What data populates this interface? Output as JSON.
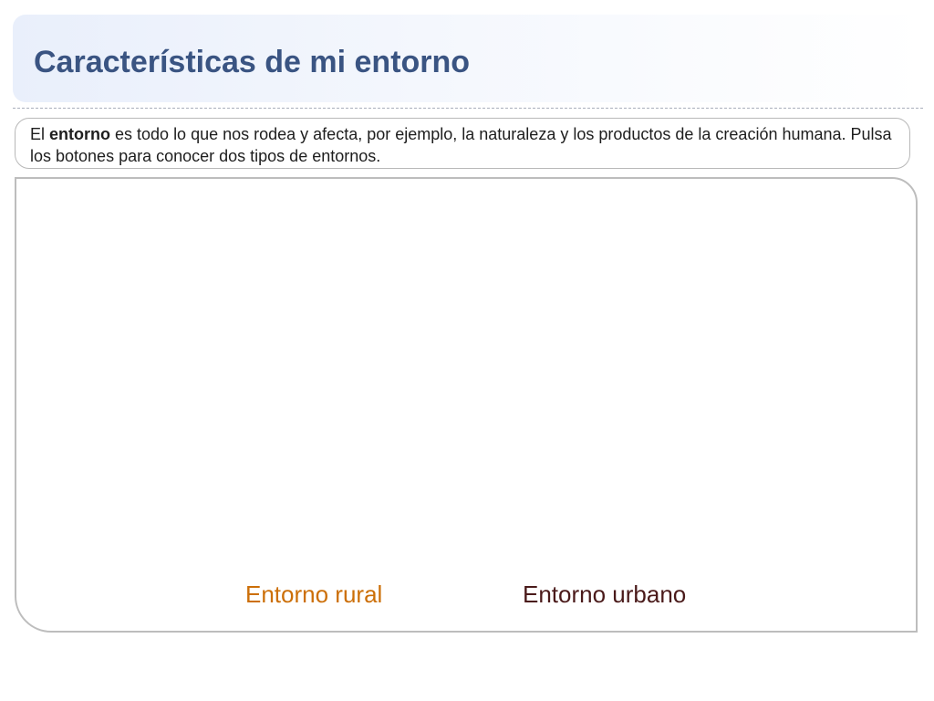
{
  "header": {
    "title": "Características de mi entorno"
  },
  "intro": {
    "prefix": "El ",
    "highlight": "entorno",
    "text": " es todo lo que nos rodea y afecta, por ejemplo, la naturaleza y los productos de la creación humana. Pulsa los botones para conocer dos tipos de entornos."
  },
  "buttons": {
    "rural": "Entorno rural",
    "urban": "Entorno urbano"
  },
  "colors": {
    "title": "#3a5482",
    "rural_button": "#cc6f08",
    "urban_button": "#4a1a1a",
    "border": "#bdbdbd"
  }
}
